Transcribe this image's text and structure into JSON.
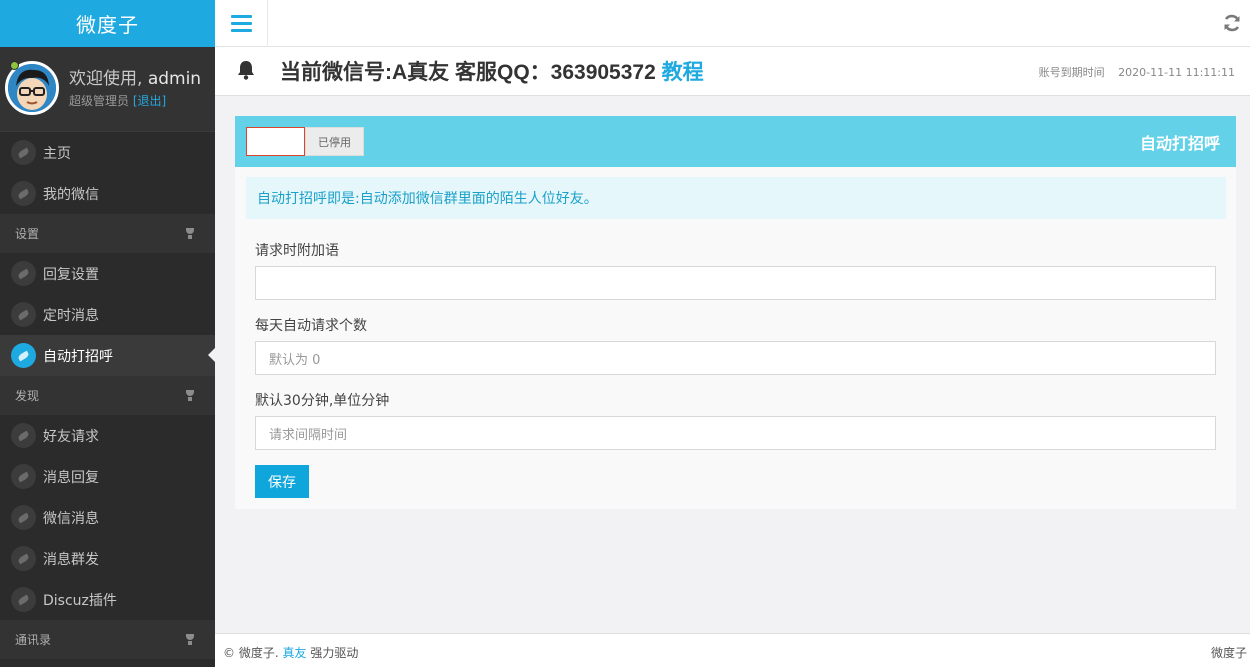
{
  "sidebar": {
    "brand": "微度子",
    "user": {
      "welcome_prefix": "欢迎使用,",
      "name": "admin",
      "role": "超级管理员",
      "logout": "[退出]"
    },
    "items": [
      {
        "label": "主页"
      },
      {
        "label": "我的微信"
      },
      {
        "section": "设置"
      },
      {
        "label": "回复设置"
      },
      {
        "label": "定时消息"
      },
      {
        "label": "自动打招呼",
        "active": true
      },
      {
        "section": "发现"
      },
      {
        "label": "好友请求"
      },
      {
        "label": "消息回复"
      },
      {
        "label": "微信消息"
      },
      {
        "label": "消息群发"
      },
      {
        "label": "Discuz插件"
      },
      {
        "section": "通讯录"
      }
    ]
  },
  "header": {
    "title": "当前微信号:A真友 客服QQ：363905372",
    "tutorial_link": "教程",
    "expire_label": "账号到期时间",
    "expire_value": "2020-11-11 11:11:11"
  },
  "panel": {
    "title": "自动打招呼",
    "toggle_status": "已停用",
    "info": "自动打招呼即是:自动添加微信群里面的陌生人位好友。",
    "fields": [
      {
        "label": "请求时附加语",
        "value": "",
        "placeholder": ""
      },
      {
        "label": "每天自动请求个数",
        "value": "",
        "placeholder": "默认为 0"
      },
      {
        "label": "默认30分钟,单位分钟",
        "value": "",
        "placeholder": "请求间隔时间"
      }
    ],
    "save_label": "保存"
  },
  "footer": {
    "copyright": "© 微度子.",
    "link": "真友",
    "powered": "强力驱动",
    "right": "微度子"
  },
  "colors": {
    "accent": "#1ea9e0",
    "sidebar_bg": "#2b2b2b",
    "panel_header": "#63d1e8",
    "info_bg": "#e6f7fb"
  },
  "icons": {
    "menu": "hamburger-icon",
    "refresh": "refresh-icon",
    "bell": "bell-icon",
    "nav": "leaf-icon",
    "section": "trophy-icon"
  }
}
